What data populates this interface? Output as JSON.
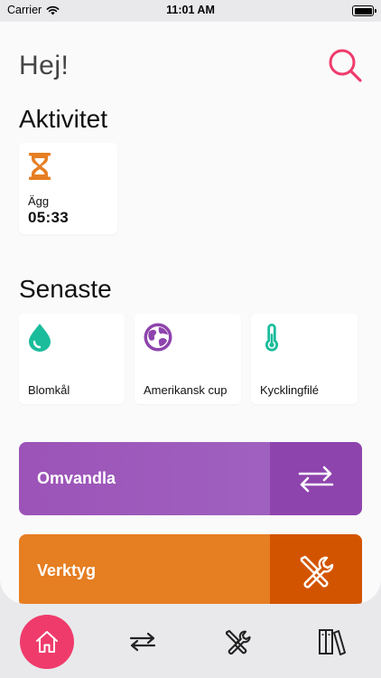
{
  "status_bar": {
    "carrier": "Carrier",
    "time": "11:01 AM"
  },
  "header": {
    "greeting": "Hej!",
    "search_icon": "search-icon"
  },
  "activity": {
    "title": "Aktivitet",
    "items": [
      {
        "icon": "hourglass-icon",
        "label": "Ägg",
        "value": "05:33",
        "color": "#e67e22"
      }
    ]
  },
  "recent": {
    "title": "Senaste",
    "items": [
      {
        "icon": "water-drop-icon",
        "label": "Blomkål",
        "color": "#1abc9c"
      },
      {
        "icon": "globe-icon",
        "label": "Amerikansk cup",
        "color": "#8e44ad"
      },
      {
        "icon": "thermometer-icon",
        "label": "Kycklingfilé",
        "color": "#1abc9c"
      }
    ]
  },
  "actions": [
    {
      "label": "Omvandla",
      "icon": "convert-arrows-icon",
      "color": "#9b59b6",
      "side_color": "#8e44ad"
    },
    {
      "label": "Verktyg",
      "icon": "tools-icon",
      "color": "#e67e22",
      "side_color": "#d35400"
    }
  ],
  "tab_bar": {
    "tabs": [
      {
        "icon": "home-icon",
        "active": true,
        "color": "#ef3b6b"
      },
      {
        "icon": "convert-arrows-icon",
        "active": false
      },
      {
        "icon": "tools-icon",
        "active": false
      },
      {
        "icon": "library-icon",
        "active": false
      }
    ]
  }
}
